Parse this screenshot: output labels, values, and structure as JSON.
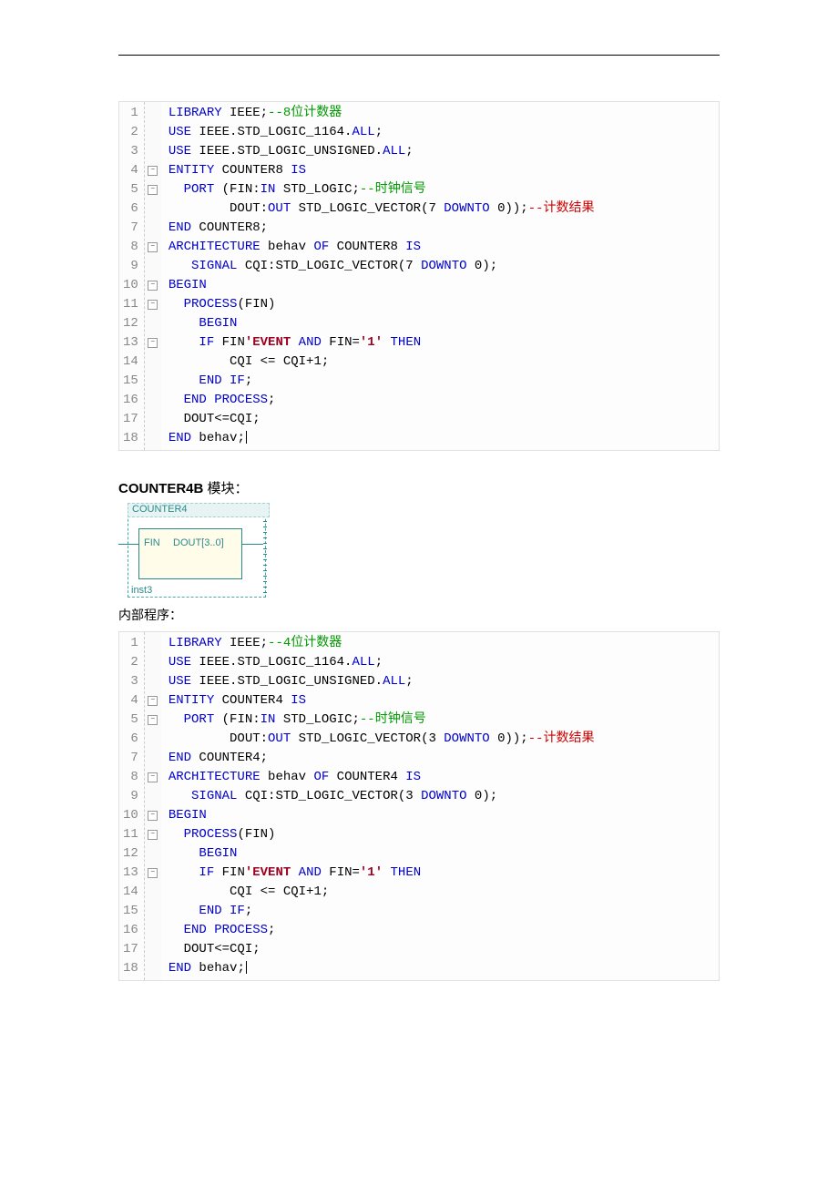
{
  "code8": {
    "lines": [
      {
        "num": "1",
        "fold": "",
        "seg": [
          [
            "kw-blue",
            "LIBRARY"
          ],
          [
            "plain-black",
            " IEEE;"
          ],
          [
            "comment-green",
            "--8位计数器"
          ]
        ]
      },
      {
        "num": "2",
        "fold": "",
        "seg": [
          [
            "kw-blue",
            "USE"
          ],
          [
            "plain-black",
            " IEEE.STD_LOGIC_1164."
          ],
          [
            "kw-blue",
            "ALL"
          ],
          [
            "plain-black",
            ";"
          ]
        ]
      },
      {
        "num": "3",
        "fold": "",
        "seg": [
          [
            "kw-blue",
            "USE"
          ],
          [
            "plain-black",
            " IEEE.STD_LOGIC_UNSIGNED."
          ],
          [
            "kw-blue",
            "ALL"
          ],
          [
            "plain-black",
            ";"
          ]
        ]
      },
      {
        "num": "4",
        "fold": "box",
        "seg": [
          [
            "kw-blue",
            "ENTITY"
          ],
          [
            "plain-black",
            " COUNTER8 "
          ],
          [
            "kw-blue",
            "IS"
          ]
        ]
      },
      {
        "num": "5",
        "fold": "box",
        "seg": [
          [
            "plain-black",
            "  "
          ],
          [
            "kw-blue",
            "PORT"
          ],
          [
            "plain-black",
            " (FIN:"
          ],
          [
            "kw-blue",
            "IN"
          ],
          [
            "plain-black",
            " STD_LOGIC;"
          ],
          [
            "comment-green",
            "--时钟信号"
          ]
        ]
      },
      {
        "num": "6",
        "fold": "",
        "seg": [
          [
            "plain-black",
            "        DOUT:"
          ],
          [
            "kw-blue",
            "OUT"
          ],
          [
            "plain-black",
            " STD_LOGIC_VECTOR(7 "
          ],
          [
            "kw-blue",
            "DOWNTO"
          ],
          [
            "plain-black",
            " 0));"
          ],
          [
            "comment-red",
            "--计数结果"
          ]
        ]
      },
      {
        "num": "7",
        "fold": "",
        "seg": [
          [
            "kw-blue",
            "END"
          ],
          [
            "plain-black",
            " COUNTER8;"
          ]
        ]
      },
      {
        "num": "8",
        "fold": "box",
        "seg": [
          [
            "kw-blue",
            "ARCHITECTURE"
          ],
          [
            "plain-black",
            " behav "
          ],
          [
            "kw-blue",
            "OF"
          ],
          [
            "plain-black",
            " COUNTER8 "
          ],
          [
            "kw-blue",
            "IS"
          ]
        ]
      },
      {
        "num": "9",
        "fold": "",
        "seg": [
          [
            "plain-black",
            "   "
          ],
          [
            "kw-blue",
            "SIGNAL"
          ],
          [
            "plain-black",
            " CQI:STD_LOGIC_VECTOR(7 "
          ],
          [
            "kw-blue",
            "DOWNTO"
          ],
          [
            "plain-black",
            " 0);"
          ]
        ]
      },
      {
        "num": "10",
        "fold": "box",
        "seg": [
          [
            "kw-blue",
            "BEGIN"
          ]
        ]
      },
      {
        "num": "11",
        "fold": "box",
        "seg": [
          [
            "plain-black",
            "  "
          ],
          [
            "kw-blue",
            "PROCESS"
          ],
          [
            "plain-black",
            "(FIN)"
          ]
        ]
      },
      {
        "num": "12",
        "fold": "",
        "seg": [
          [
            "plain-black",
            "    "
          ],
          [
            "kw-blue",
            "BEGIN"
          ]
        ]
      },
      {
        "num": "13",
        "fold": "box",
        "seg": [
          [
            "plain-black",
            "    "
          ],
          [
            "kw-blue",
            "IF"
          ],
          [
            "plain-black",
            " FIN"
          ],
          [
            "kw-red",
            "'EVENT"
          ],
          [
            "plain-black",
            " "
          ],
          [
            "kw-blue",
            "AND"
          ],
          [
            "plain-black",
            " FIN="
          ],
          [
            "kw-red",
            "'1'"
          ],
          [
            "plain-black",
            " "
          ],
          [
            "kw-blue",
            "THEN"
          ]
        ]
      },
      {
        "num": "14",
        "fold": "",
        "seg": [
          [
            "plain-black",
            "        CQI <= CQI+1;"
          ]
        ]
      },
      {
        "num": "15",
        "fold": "",
        "seg": [
          [
            "plain-black",
            "    "
          ],
          [
            "kw-blue",
            "END IF"
          ],
          [
            "plain-black",
            ";"
          ]
        ]
      },
      {
        "num": "16",
        "fold": "",
        "seg": [
          [
            "plain-black",
            "  "
          ],
          [
            "kw-blue",
            "END PROCESS"
          ],
          [
            "plain-black",
            ";"
          ]
        ]
      },
      {
        "num": "17",
        "fold": "",
        "seg": [
          [
            "plain-black",
            "  DOUT<=CQI;"
          ]
        ]
      },
      {
        "num": "18",
        "fold": "",
        "seg": [
          [
            "kw-blue",
            "END"
          ],
          [
            "plain-black",
            " behav;"
          ]
        ],
        "cursor": true
      }
    ]
  },
  "section": {
    "title_bold": "COUNTER4B",
    "title_rest": " 模块："
  },
  "diagram": {
    "title": "COUNTER4",
    "pin_in": "FIN",
    "pin_out": "DOUT[3..0]",
    "inst": "inst3"
  },
  "subtext": "内部程序：",
  "code4": {
    "lines": [
      {
        "num": "1",
        "fold": "",
        "seg": [
          [
            "kw-blue",
            "LIBRARY"
          ],
          [
            "plain-black",
            " IEEE;"
          ],
          [
            "comment-green",
            "--4位计数器"
          ]
        ]
      },
      {
        "num": "2",
        "fold": "",
        "seg": [
          [
            "kw-blue",
            "USE"
          ],
          [
            "plain-black",
            " IEEE.STD_LOGIC_1164."
          ],
          [
            "kw-blue",
            "ALL"
          ],
          [
            "plain-black",
            ";"
          ]
        ]
      },
      {
        "num": "3",
        "fold": "",
        "seg": [
          [
            "kw-blue",
            "USE"
          ],
          [
            "plain-black",
            " IEEE.STD_LOGIC_UNSIGNED."
          ],
          [
            "kw-blue",
            "ALL"
          ],
          [
            "plain-black",
            ";"
          ]
        ]
      },
      {
        "num": "4",
        "fold": "box",
        "seg": [
          [
            "kw-blue",
            "ENTITY"
          ],
          [
            "plain-black",
            " COUNTER4 "
          ],
          [
            "kw-blue",
            "IS"
          ]
        ]
      },
      {
        "num": "5",
        "fold": "box",
        "seg": [
          [
            "plain-black",
            "  "
          ],
          [
            "kw-blue",
            "PORT"
          ],
          [
            "plain-black",
            " (FIN:"
          ],
          [
            "kw-blue",
            "IN"
          ],
          [
            "plain-black",
            " STD_LOGIC;"
          ],
          [
            "comment-green",
            "--时钟信号"
          ]
        ]
      },
      {
        "num": "6",
        "fold": "",
        "seg": [
          [
            "plain-black",
            "        DOUT:"
          ],
          [
            "kw-blue",
            "OUT"
          ],
          [
            "plain-black",
            " STD_LOGIC_VECTOR(3 "
          ],
          [
            "kw-blue",
            "DOWNTO"
          ],
          [
            "plain-black",
            " 0));"
          ],
          [
            "comment-red",
            "--计数结果"
          ]
        ]
      },
      {
        "num": "7",
        "fold": "",
        "seg": [
          [
            "kw-blue",
            "END"
          ],
          [
            "plain-black",
            " COUNTER4;"
          ]
        ]
      },
      {
        "num": "8",
        "fold": "box",
        "seg": [
          [
            "kw-blue",
            "ARCHITECTURE"
          ],
          [
            "plain-black",
            " behav "
          ],
          [
            "kw-blue",
            "OF"
          ],
          [
            "plain-black",
            " COUNTER4 "
          ],
          [
            "kw-blue",
            "IS"
          ]
        ]
      },
      {
        "num": "9",
        "fold": "",
        "seg": [
          [
            "plain-black",
            "   "
          ],
          [
            "kw-blue",
            "SIGNAL"
          ],
          [
            "plain-black",
            " CQI:STD_LOGIC_VECTOR(3 "
          ],
          [
            "kw-blue",
            "DOWNTO"
          ],
          [
            "plain-black",
            " 0);"
          ]
        ]
      },
      {
        "num": "10",
        "fold": "box",
        "seg": [
          [
            "kw-blue",
            "BEGIN"
          ]
        ]
      },
      {
        "num": "11",
        "fold": "box",
        "seg": [
          [
            "plain-black",
            "  "
          ],
          [
            "kw-blue",
            "PROCESS"
          ],
          [
            "plain-black",
            "(FIN)"
          ]
        ]
      },
      {
        "num": "12",
        "fold": "",
        "seg": [
          [
            "plain-black",
            "    "
          ],
          [
            "kw-blue",
            "BEGIN"
          ]
        ]
      },
      {
        "num": "13",
        "fold": "box",
        "seg": [
          [
            "plain-black",
            "    "
          ],
          [
            "kw-blue",
            "IF"
          ],
          [
            "plain-black",
            " FIN"
          ],
          [
            "kw-red",
            "'EVENT"
          ],
          [
            "plain-black",
            " "
          ],
          [
            "kw-blue",
            "AND"
          ],
          [
            "plain-black",
            " FIN="
          ],
          [
            "kw-red",
            "'1'"
          ],
          [
            "plain-black",
            " "
          ],
          [
            "kw-blue",
            "THEN"
          ]
        ]
      },
      {
        "num": "14",
        "fold": "",
        "seg": [
          [
            "plain-black",
            "        CQI <= CQI+1;"
          ]
        ]
      },
      {
        "num": "15",
        "fold": "",
        "seg": [
          [
            "plain-black",
            "    "
          ],
          [
            "kw-blue",
            "END IF"
          ],
          [
            "plain-black",
            ";"
          ]
        ]
      },
      {
        "num": "16",
        "fold": "",
        "seg": [
          [
            "plain-black",
            "  "
          ],
          [
            "kw-blue",
            "END PROCESS"
          ],
          [
            "plain-black",
            ";"
          ]
        ]
      },
      {
        "num": "17",
        "fold": "",
        "seg": [
          [
            "plain-black",
            "  DOUT<=CQI;"
          ]
        ]
      },
      {
        "num": "18",
        "fold": "",
        "seg": [
          [
            "kw-blue",
            "END"
          ],
          [
            "plain-black",
            " behav;"
          ]
        ],
        "cursor": true
      }
    ]
  }
}
